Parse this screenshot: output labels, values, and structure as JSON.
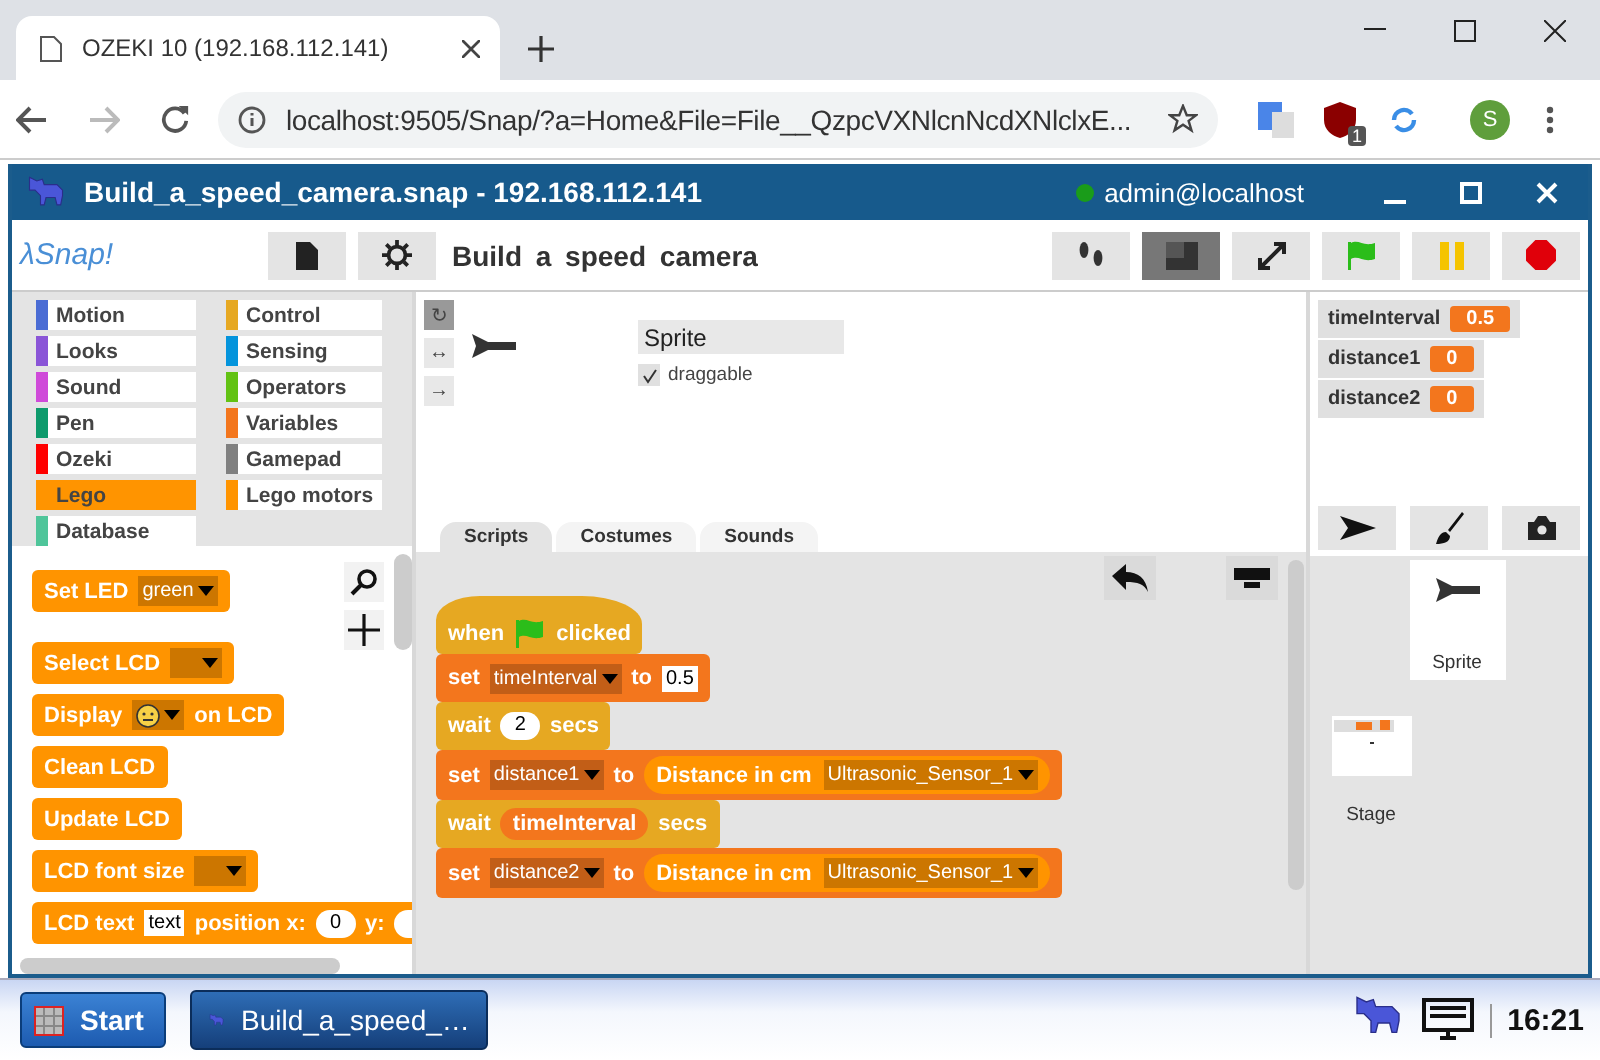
{
  "browser": {
    "tab_title": "OZEKI 10 (192.168.112.141)",
    "url": "localhost:9505/Snap/?a=Home&File=File__QzpcVXNlcnNcdXNlclxE...",
    "extension_badge": "1",
    "profile": "S"
  },
  "window": {
    "title": "Build_a_speed_camera.snap - 192.168.112.141",
    "user": "admin@localhost",
    "online": true
  },
  "toolbar": {
    "logo": "λSnap!",
    "project_title": "Build a speed camera",
    "buttons": [
      {
        "kind": "file",
        "selected": false
      },
      {
        "kind": "settings",
        "selected": false
      },
      {
        "kind": "footprints",
        "selected": false
      },
      {
        "kind": "stage-size",
        "selected": true
      },
      {
        "kind": "fullscreen",
        "selected": false
      },
      {
        "kind": "start",
        "selected": false
      },
      {
        "kind": "pause",
        "selected": false
      },
      {
        "kind": "stop",
        "selected": false
      }
    ]
  },
  "categories": [
    {
      "label": "Motion",
      "color": "#4a6cd4",
      "selected": false
    },
    {
      "label": "Looks",
      "color": "#8a55d7",
      "selected": false
    },
    {
      "label": "Sound",
      "color": "#cf4ad9",
      "selected": false
    },
    {
      "label": "Pen",
      "color": "#0e9a6c",
      "selected": false
    },
    {
      "label": "Ozeki",
      "color": "#ff0000",
      "selected": false
    },
    {
      "label": "Lego",
      "color": "#ff9400",
      "selected": true
    },
    {
      "label": "Database",
      "color": "#4fc59a",
      "selected": false
    },
    {
      "label": "Control",
      "color": "#e6a822",
      "selected": false
    },
    {
      "label": "Sensing",
      "color": "#0494dc",
      "selected": false
    },
    {
      "label": "Operators",
      "color": "#62c213",
      "selected": false
    },
    {
      "label": "Variables",
      "color": "#f3761d",
      "selected": false
    },
    {
      "label": "Gamepad",
      "color": "#808080",
      "selected": false
    },
    {
      "label": "Lego motors",
      "color": "#ff9400",
      "selected": false
    }
  ],
  "palette_blocks": [
    {
      "color": "#ff9400",
      "parts": [
        {
          "kind": "label",
          "text": "Set LED"
        },
        {
          "kind": "dropdown",
          "text": "green"
        }
      ]
    },
    {
      "color": "#ff9400",
      "parts": [
        {
          "kind": "label",
          "text": "Select LCD"
        },
        {
          "kind": "dropdown"
        }
      ]
    },
    {
      "color": "#ff9400",
      "parts": [
        {
          "kind": "label",
          "text": "Display"
        },
        {
          "kind": "face"
        },
        {
          "kind": "label",
          "text": "on LCD"
        }
      ]
    },
    {
      "color": "#ff9400",
      "parts": [
        {
          "kind": "label",
          "text": "Clean LCD"
        }
      ]
    },
    {
      "color": "#ff9400",
      "parts": [
        {
          "kind": "label",
          "text": "Update LCD"
        }
      ]
    },
    {
      "color": "#ff9400",
      "parts": [
        {
          "kind": "label",
          "text": "LCD font size"
        },
        {
          "kind": "dropdown"
        }
      ]
    },
    {
      "color": "#ff9400",
      "parts": [
        {
          "kind": "label",
          "text": "LCD text"
        },
        {
          "kind": "input",
          "text": "text"
        },
        {
          "kind": "label",
          "text": "position x:"
        },
        {
          "kind": "number",
          "text": "0"
        },
        {
          "kind": "label",
          "text": "y:"
        },
        {
          "kind": "number"
        }
      ]
    }
  ],
  "sprite_info": {
    "name": "Sprite",
    "draggable_label": "draggable",
    "draggable": true,
    "rotation_styles": [
      {
        "label": "↻",
        "selected": true
      },
      {
        "label": "↔",
        "selected": false
      },
      {
        "label": "→",
        "selected": false
      }
    ]
  },
  "tabs": [
    {
      "label": "Scripts",
      "selected": true
    },
    {
      "label": "Costumes",
      "selected": false
    },
    {
      "label": "Sounds",
      "selected": false
    }
  ],
  "script": [
    {
      "kind": "hat",
      "color": "#e6a822",
      "parts": [
        {
          "kind": "label",
          "text": "when"
        },
        {
          "kind": "flag"
        },
        {
          "kind": "label",
          "text": "clicked"
        }
      ]
    },
    {
      "kind": "command",
      "color": "#f3761d",
      "parts": [
        {
          "kind": "label",
          "text": "set"
        },
        {
          "kind": "dropdown",
          "text": "timeInterval"
        },
        {
          "kind": "label",
          "text": "to"
        },
        {
          "kind": "input",
          "text": "0.5"
        }
      ]
    },
    {
      "kind": "command",
      "color": "#e6a822",
      "parts": [
        {
          "kind": "label",
          "text": "wait"
        },
        {
          "kind": "number",
          "text": "2"
        },
        {
          "kind": "label",
          "text": "secs"
        }
      ]
    },
    {
      "kind": "command",
      "color": "#f3761d",
      "parts": [
        {
          "kind": "label",
          "text": "set"
        },
        {
          "kind": "dropdown",
          "text": "distance1"
        },
        {
          "kind": "label",
          "text": "to"
        },
        {
          "kind": "reporter",
          "color": "#ff9400",
          "parts": [
            {
              "kind": "label",
              "text": "Distance in cm"
            },
            {
              "kind": "dropdown",
              "text": "Ultrasonic_Sensor_1"
            }
          ]
        }
      ]
    },
    {
      "kind": "command",
      "color": "#e6a822",
      "parts": [
        {
          "kind": "label",
          "text": "wait"
        },
        {
          "kind": "reporter",
          "color": "#f3761d",
          "parts": [
            {
              "kind": "label",
              "text": "timeInterval"
            }
          ]
        },
        {
          "kind": "label",
          "text": "secs"
        }
      ]
    },
    {
      "kind": "command",
      "color": "#f3761d",
      "parts": [
        {
          "kind": "label",
          "text": "set"
        },
        {
          "kind": "dropdown",
          "text": "distance2"
        },
        {
          "kind": "label",
          "text": "to"
        },
        {
          "kind": "reporter",
          "color": "#ff9400",
          "parts": [
            {
              "kind": "label",
              "text": "Distance in cm"
            },
            {
              "kind": "dropdown",
              "text": "Ultrasonic_Sensor_1"
            }
          ]
        }
      ]
    }
  ],
  "watchers": [
    {
      "name": "timeInterval",
      "value": "0.5"
    },
    {
      "name": "distance1",
      "value": "0"
    },
    {
      "name": "distance2",
      "value": "0"
    }
  ],
  "sprites": [
    {
      "name": "Sprite",
      "selected": true
    }
  ],
  "stage": {
    "name": "Stage"
  },
  "taskbar": {
    "start": "Start",
    "task": "Build_a_speed_…",
    "clock": "16:21"
  }
}
